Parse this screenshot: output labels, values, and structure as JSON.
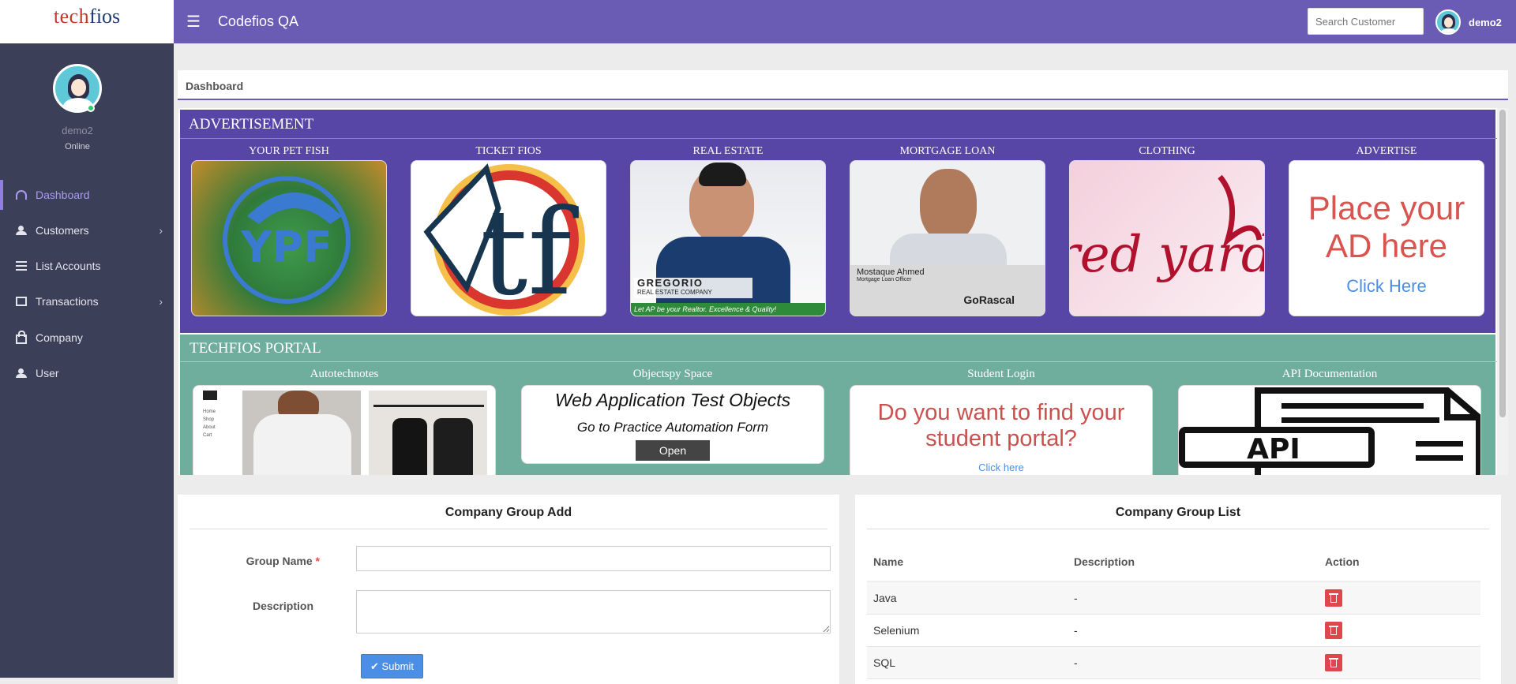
{
  "header": {
    "logo_part1": "tech",
    "logo_part2": "fios",
    "app_title": "Codefios QA",
    "search_placeholder": "Search Customer",
    "username": "demo2"
  },
  "sidebar": {
    "username": "demo2",
    "status": "Online",
    "items": [
      {
        "label": "Dashboard",
        "icon": "dashboard-icon",
        "active": true
      },
      {
        "label": "Customers",
        "icon": "users-icon",
        "has_submenu": true
      },
      {
        "label": "List Accounts",
        "icon": "list-icon"
      },
      {
        "label": "Transactions",
        "icon": "building-icon",
        "has_submenu": true
      },
      {
        "label": "Company",
        "icon": "lock-icon"
      },
      {
        "label": "User",
        "icon": "users-icon"
      }
    ]
  },
  "page": {
    "title": "Dashboard"
  },
  "advertisement": {
    "title": "ADVERTISEMENT",
    "cards": [
      {
        "caption": "YOUR PET FISH",
        "logo_text": "YPF"
      },
      {
        "caption": "TICKET FIOS",
        "logo_text": "tf"
      },
      {
        "caption": "REAL ESTATE",
        "brand": "GREGORIO",
        "brand_sub": "REAL ESTATE COMPANY",
        "tagline": "Let AP be your Realtor. Excellence & Quality!"
      },
      {
        "caption": "MORTGAGE LOAN",
        "name": "Mostaque Ahmed",
        "role": "Mortgage Loan Officer",
        "brand": "GoRascal"
      },
      {
        "caption": "CLOTHING",
        "logo_text": "red yard"
      },
      {
        "caption": "ADVERTISE",
        "line1": "Place your",
        "line2": "AD here",
        "link": "Click Here"
      }
    ]
  },
  "portal": {
    "title": "TECHFIOS PORTAL",
    "cards": [
      {
        "caption": "Autotechnotes",
        "menu": [
          "Home",
          "Shop",
          "About",
          "Cart"
        ]
      },
      {
        "caption": "Objectspy Space",
        "heading": "Web Application Test Objects",
        "sub": "Go to Practice Automation Form",
        "button": "Open"
      },
      {
        "caption": "Student Login",
        "heading": "Do you want to find your student portal?",
        "link": "Click here"
      },
      {
        "caption": "API Documentation",
        "logo_text": "API"
      }
    ]
  },
  "group_add": {
    "title": "Company Group Add",
    "group_name_label": "Group Name",
    "required_mark": "*",
    "description_label": "Description",
    "group_name_value": "",
    "description_value": "",
    "submit_label": "Submit"
  },
  "group_list": {
    "title": "Company Group List",
    "columns": [
      "Name",
      "Description",
      "Action"
    ],
    "rows": [
      {
        "name": "Java",
        "description": "-"
      },
      {
        "name": "Selenium",
        "description": "-"
      },
      {
        "name": "SQL",
        "description": "-"
      }
    ]
  },
  "colors": {
    "topbar": "#6a5bb5",
    "sidebar": "#3b3f58",
    "advertisement_bg": "#5746a5",
    "portal_bg": "#6fae9c",
    "delete_button": "#e0474c",
    "submit_button": "#4b8ee6"
  }
}
